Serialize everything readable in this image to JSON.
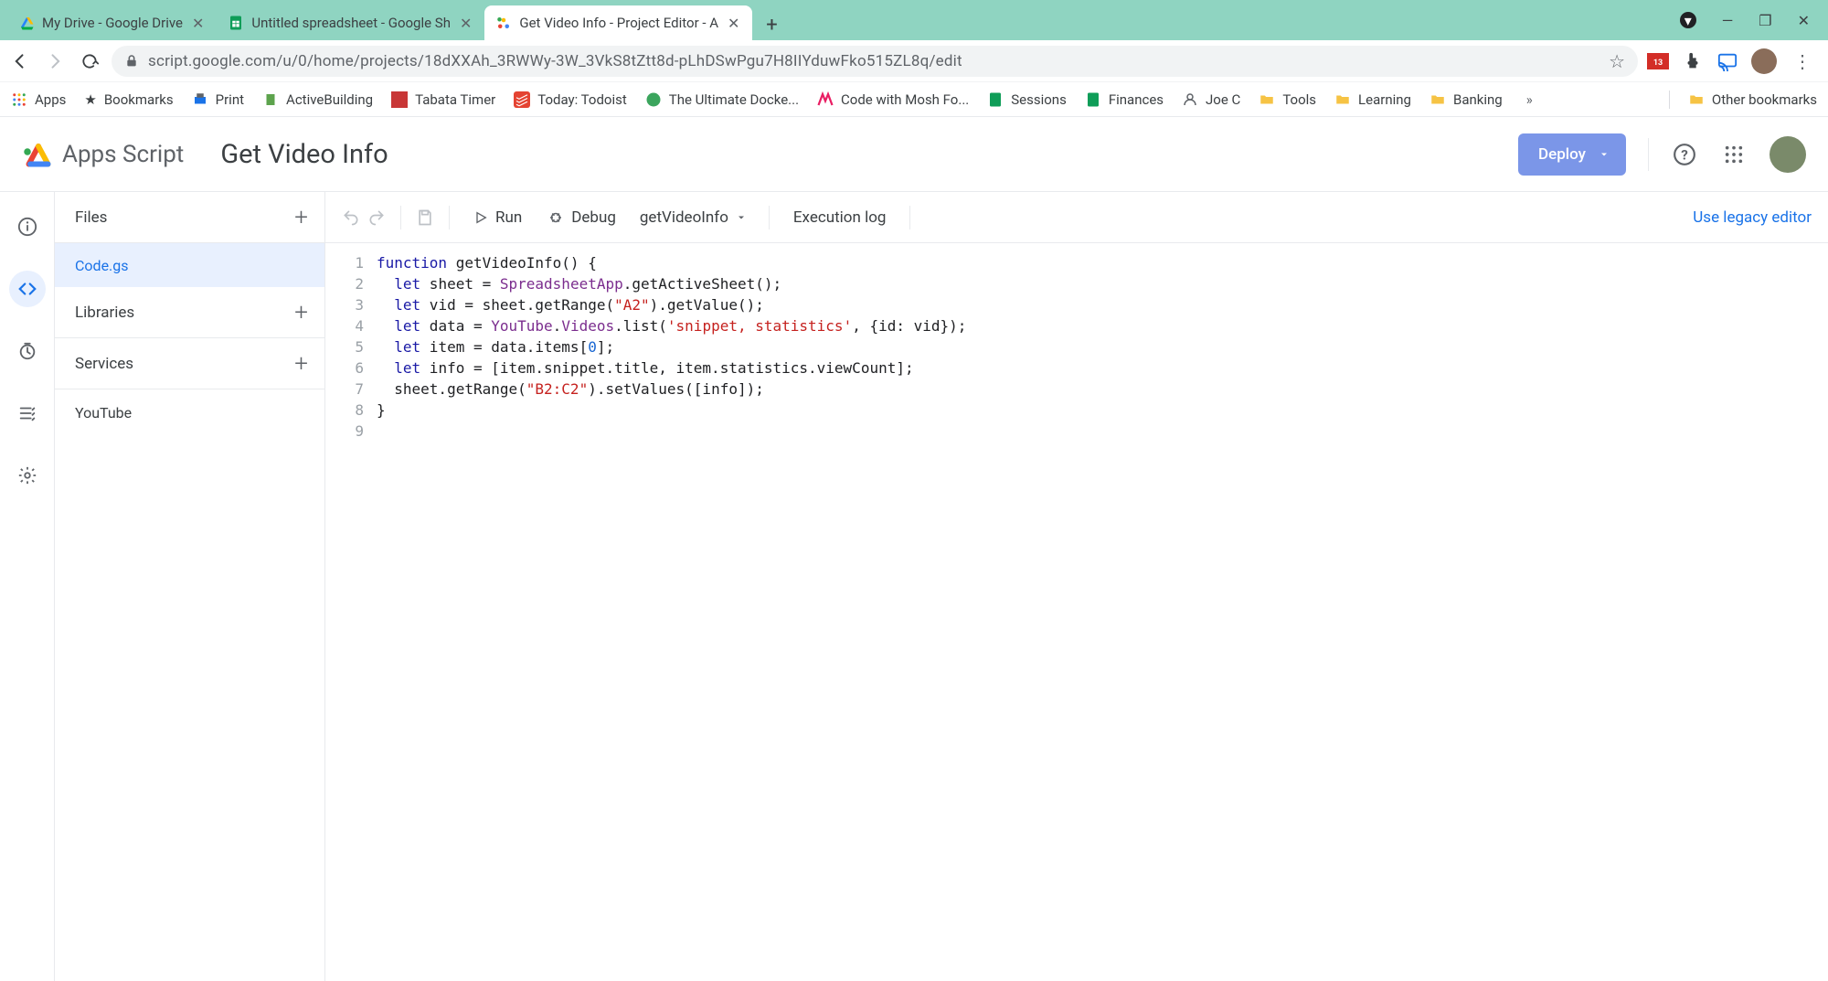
{
  "browser": {
    "tabs": [
      {
        "title": "My Drive - Google Drive"
      },
      {
        "title": "Untitled spreadsheet - Google Sh"
      },
      {
        "title": "Get Video Info - Project Editor - A"
      }
    ],
    "url_host": "script.google.com",
    "url_path": "/u/0/home/projects/18dXXAh_3RWWy-3W_3VkS8tZtt8d-pLhDSwPgu7H8IIYduwFko515ZL8q/edit",
    "bookmarks": [
      {
        "label": "Apps"
      },
      {
        "label": "Bookmarks"
      },
      {
        "label": "Print"
      },
      {
        "label": "ActiveBuilding"
      },
      {
        "label": "Tabata Timer"
      },
      {
        "label": "Today: Todoist"
      },
      {
        "label": "The Ultimate Docke..."
      },
      {
        "label": "Code with Mosh Fo..."
      },
      {
        "label": "Sessions"
      },
      {
        "label": "Finances"
      },
      {
        "label": "Joe C"
      },
      {
        "label": "Tools"
      },
      {
        "label": "Learning"
      },
      {
        "label": "Banking"
      }
    ],
    "other_bookmarks": "Other bookmarks",
    "overflow_glyph": "»"
  },
  "header": {
    "product": "Apps Script",
    "title": "Get Video Info",
    "deploy": "Deploy"
  },
  "sidebar": {
    "files_label": "Files",
    "file_name": "Code.gs",
    "libraries_label": "Libraries",
    "services_label": "Services",
    "service_item": "YouTube"
  },
  "toolbar": {
    "run": "Run",
    "debug": "Debug",
    "fn": "getVideoInfo",
    "exec_log": "Execution log",
    "legacy": "Use legacy editor"
  },
  "code": {
    "lines": [
      "1",
      "2",
      "3",
      "4",
      "5",
      "6",
      "7",
      "8",
      "9"
    ],
    "tokens": [
      [
        {
          "t": "function",
          "c": "kw"
        },
        {
          "t": " getVideoInfo() {"
        }
      ],
      [
        {
          "t": "  "
        },
        {
          "t": "let",
          "c": "kw"
        },
        {
          "t": " sheet = "
        },
        {
          "t": "SpreadsheetApp",
          "c": "cls"
        },
        {
          "t": ".getActiveSheet();"
        }
      ],
      [
        {
          "t": "  "
        },
        {
          "t": "let",
          "c": "kw"
        },
        {
          "t": " vid = sheet.getRange("
        },
        {
          "t": "\"A2\"",
          "c": "str"
        },
        {
          "t": ").getValue();"
        }
      ],
      [
        {
          "t": "  "
        },
        {
          "t": "let",
          "c": "kw"
        },
        {
          "t": " data = "
        },
        {
          "t": "YouTube",
          "c": "cls"
        },
        {
          "t": "."
        },
        {
          "t": "Videos",
          "c": "cls"
        },
        {
          "t": ".list("
        },
        {
          "t": "'snippet, statistics'",
          "c": "str"
        },
        {
          "t": ", {id: vid});"
        }
      ],
      [
        {
          "t": "  "
        },
        {
          "t": "let",
          "c": "kw"
        },
        {
          "t": " item = data.items["
        },
        {
          "t": "0",
          "c": "num"
        },
        {
          "t": "];"
        }
      ],
      [
        {
          "t": "  "
        },
        {
          "t": "let",
          "c": "kw"
        },
        {
          "t": " info = [item.snippet.title, item.statistics.viewCount];"
        }
      ],
      [
        {
          "t": "  sheet.getRange("
        },
        {
          "t": "\"B2:C2\"",
          "c": "str"
        },
        {
          "t": ").setValues([info]);"
        }
      ],
      [
        {
          "t": "}"
        }
      ],
      [
        {
          "t": ""
        }
      ]
    ]
  }
}
